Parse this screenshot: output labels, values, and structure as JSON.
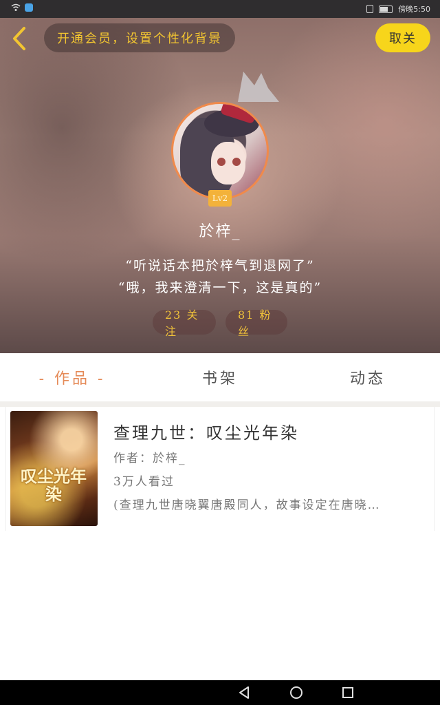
{
  "status_bar": {
    "time": "傍晚5:50"
  },
  "header": {
    "vip_banner": "开通会员，设置个性化背景",
    "follow_button": "取关"
  },
  "profile": {
    "level": "Lv2",
    "username": "於梓_",
    "bio_line1": "“听说话本把於梓气到退网了”",
    "bio_line2": "“哦，我来澄清一下，这是真的”",
    "following": "23 关注",
    "followers": "81 粉丝"
  },
  "tabs": [
    {
      "label": "- 作品 -",
      "active": true
    },
    {
      "label": "书架",
      "active": false
    },
    {
      "label": "动态",
      "active": false
    }
  ],
  "works": [
    {
      "cover_title": "叹尘光年染",
      "title": "查理九世：叹尘光年染",
      "author": "作者：於梓_",
      "views": "3万人看过",
      "summary": "(查理九世唐晓翼唐殿同人，故事设定在唐晓…"
    }
  ],
  "colors": {
    "accent_yellow": "#f7d51b",
    "accent_orange": "#e58a57",
    "gold_text": "#f0c23a"
  },
  "icons": {
    "back": "chevron-left-icon",
    "crown": "crown-icon",
    "nav_back": "triangle-back-icon",
    "nav_home": "circle-home-icon",
    "nav_recent": "square-recent-icon"
  }
}
